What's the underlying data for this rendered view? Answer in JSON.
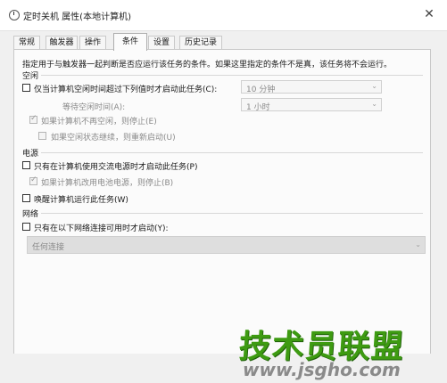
{
  "window": {
    "title": "定时关机 属性(本地计算机)",
    "close_glyph": "✕"
  },
  "tabs": [
    {
      "label": "常规"
    },
    {
      "label": "触发器"
    },
    {
      "label": "操作"
    },
    {
      "label": "条件",
      "active": true
    },
    {
      "label": "设置"
    },
    {
      "label": "历史记录"
    }
  ],
  "conditions": {
    "description": "指定用于与触发器一起判断是否应运行该任务的条件。如果这里指定的条件不是真，该任务将不会运行。",
    "idle": {
      "header": "空闲",
      "start_if_idle": {
        "label": "仅当计算机空闲时间超过下列值时才启动此任务(C):",
        "checked": false
      },
      "idle_duration": "10 分钟",
      "wait_label": "等待空闲时间(A):",
      "wait_value": "1 小时",
      "stop_on_idle_end": {
        "label": "如果计算机不再空闲，则停止(E)",
        "checked": true,
        "enabled": false
      },
      "restart_on_idle": {
        "label": "如果空闲状态继续，则重新启动(U)",
        "checked": false,
        "enabled": false
      }
    },
    "power": {
      "header": "电源",
      "ac_only": {
        "label": "只有在计算机使用交流电源时才启动此任务(P)",
        "checked": false
      },
      "stop_on_battery": {
        "label": "如果计算机改用电池电源，则停止(B)",
        "checked": true,
        "enabled": false
      },
      "wake": {
        "label": "唤醒计算机运行此任务(W)",
        "checked": false
      }
    },
    "network": {
      "header": "网络",
      "only_if_network": {
        "label": "只有在以下网络连接可用时才启动(Y):",
        "checked": false
      },
      "connection": "任何连接"
    }
  },
  "watermark": {
    "text": "技术员联盟",
    "url": "www.jsgho.com"
  },
  "colors": {
    "watermark_green": "#3e9b12",
    "panel": "#fbfbfb",
    "window_bg": "#f0f0f0"
  }
}
